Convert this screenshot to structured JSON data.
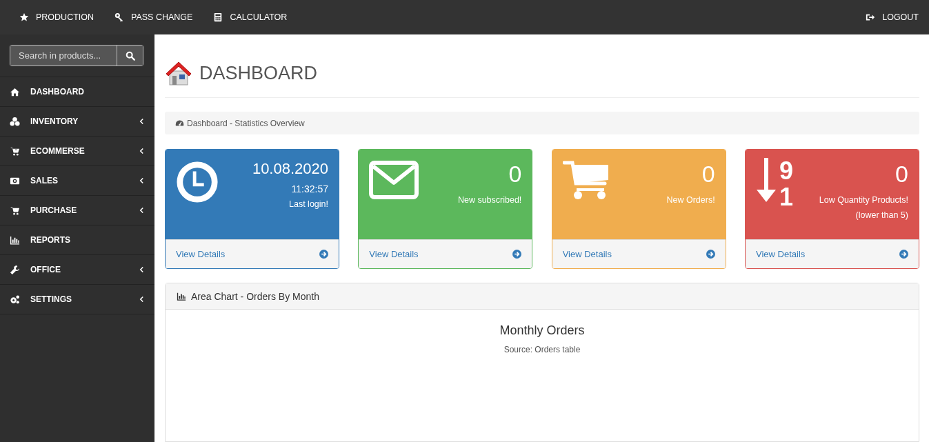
{
  "topnav": {
    "left": [
      {
        "kind": "star",
        "label": "PRODUCTION"
      },
      {
        "kind": "key",
        "label": "PASS CHANGE"
      },
      {
        "kind": "calculator",
        "label": "CALCULATOR"
      }
    ],
    "right": [
      {
        "kind": "logout",
        "label": "LOGOUT"
      }
    ]
  },
  "sidebar": {
    "search": {
      "placeholder": "Search in products..."
    },
    "items": [
      {
        "kind": "home",
        "label": "DASHBOARD",
        "has_submenu": false
      },
      {
        "kind": "cubes",
        "label": "INVENTORY",
        "has_submenu": true
      },
      {
        "kind": "cart-plus",
        "label": "ECOMMERSE",
        "has_submenu": true
      },
      {
        "kind": "money",
        "label": "SALES",
        "has_submenu": true
      },
      {
        "kind": "cart",
        "label": "PURCHASE",
        "has_submenu": true
      },
      {
        "kind": "chart",
        "label": "REPORTS",
        "has_submenu": false
      },
      {
        "kind": "wrench",
        "label": "OFFICE",
        "has_submenu": true
      },
      {
        "kind": "gears",
        "label": "SETTINGS",
        "has_submenu": true
      }
    ]
  },
  "page": {
    "title": "DASHBOARD",
    "breadcrumb": "Dashboard - Statistics Overview"
  },
  "cards": [
    {
      "kind": "clock",
      "color": "#337ab7",
      "value": "10.08.2020",
      "lines": [
        "11:32:57",
        "Last login!"
      ],
      "link": "View Details"
    },
    {
      "kind": "envelope",
      "color": "#5cb85c",
      "value": "0",
      "lines": [
        "New subscribed!"
      ],
      "link": "View Details"
    },
    {
      "kind": "cart",
      "color": "#f0ad4e",
      "value": "0",
      "lines": [
        "New Orders!"
      ],
      "link": "View Details"
    },
    {
      "kind": "sort",
      "color": "#d9534f",
      "icon_digits": [
        "9",
        "1"
      ],
      "value": "0",
      "lines": [
        "Low Quantity Products!",
        "(lower than 5)"
      ],
      "link": "View Details"
    }
  ],
  "chart_panel": {
    "heading": "Area Chart - Orders By Month",
    "title": "Monthly Orders",
    "subtitle": "Source: Orders table"
  }
}
